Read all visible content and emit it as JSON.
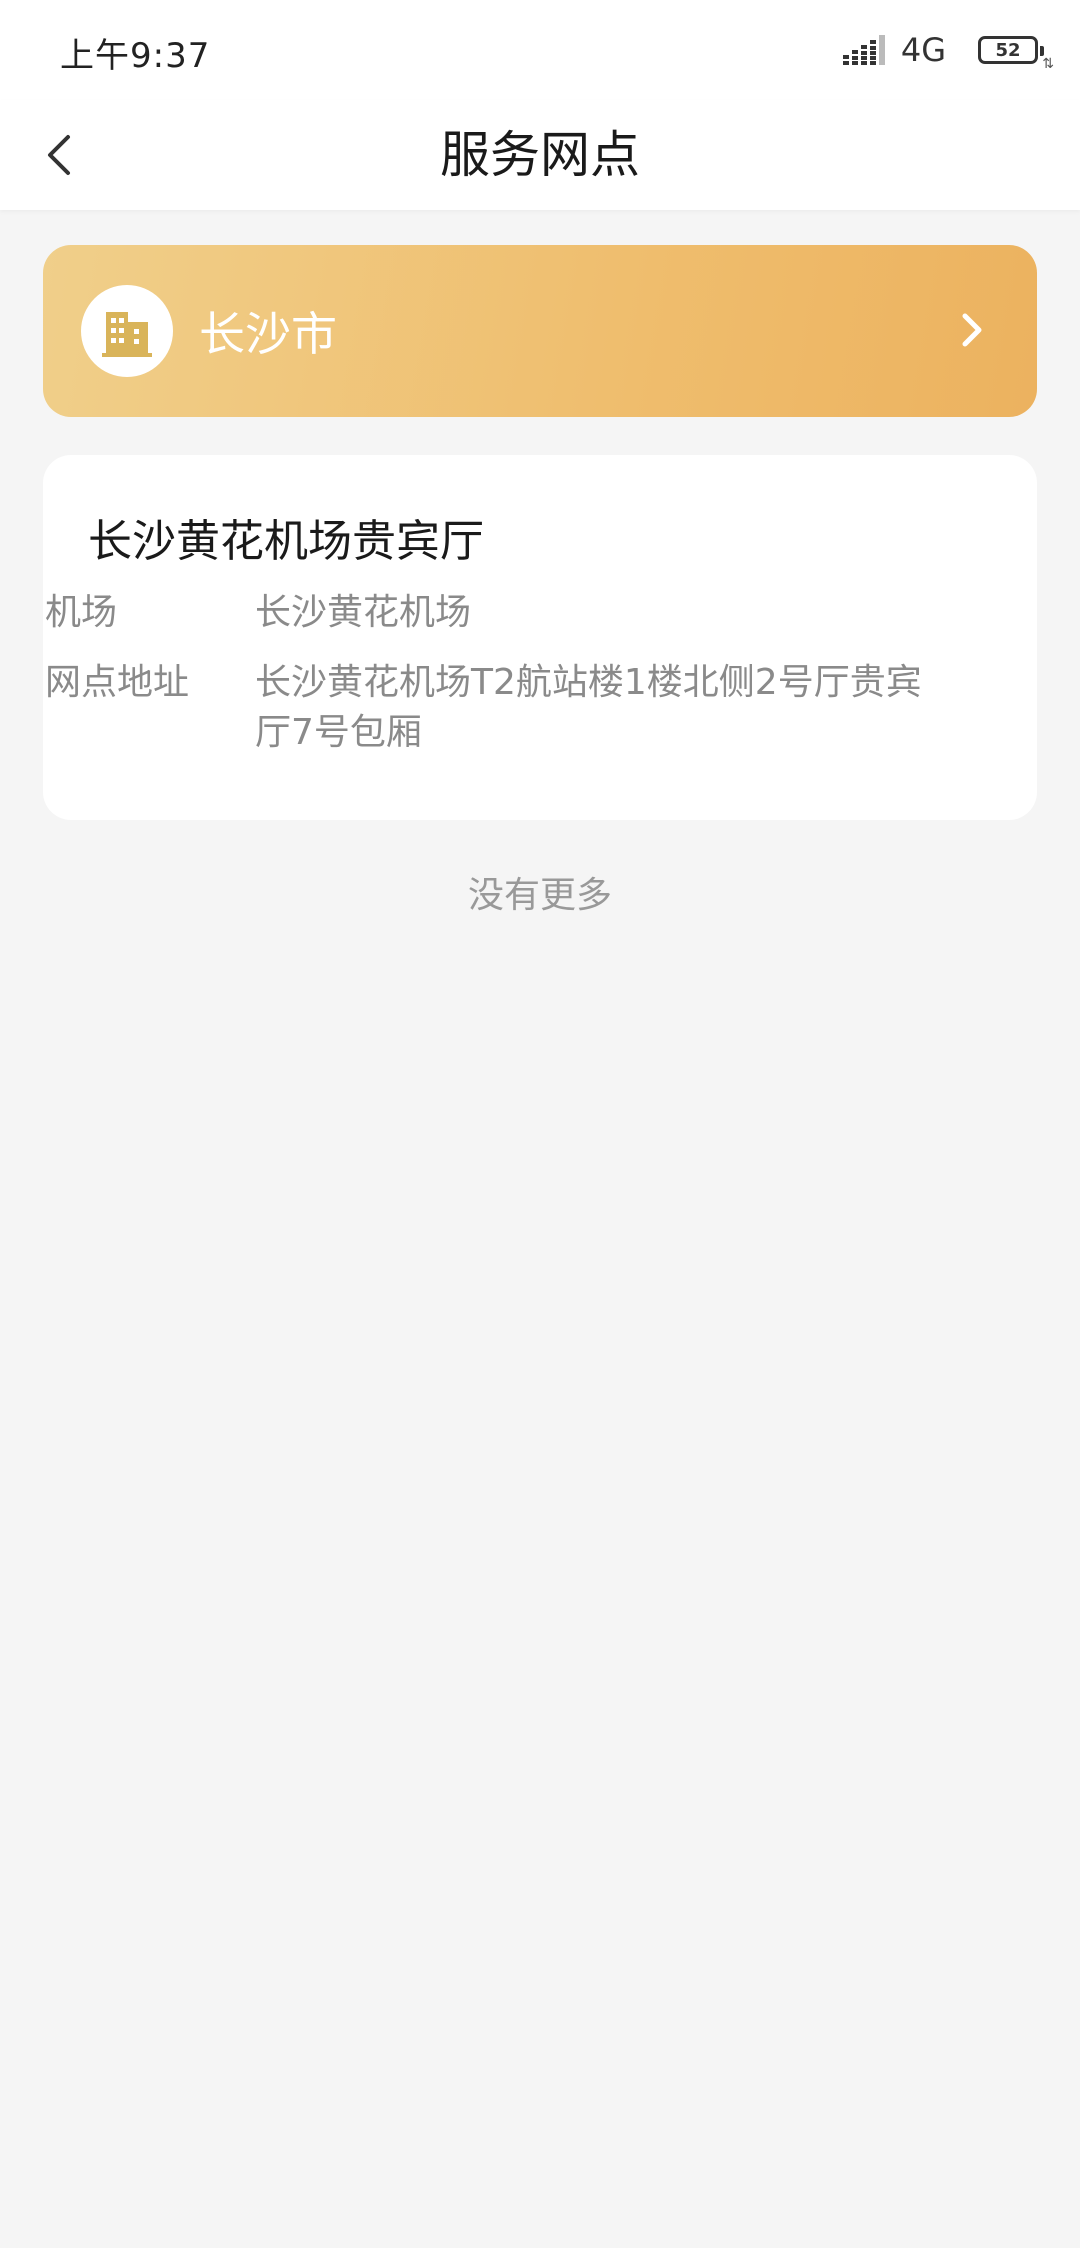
{
  "status_bar": {
    "time": "上午9:37",
    "network": "4G",
    "battery": "52"
  },
  "header": {
    "title": "服务网点"
  },
  "city": {
    "name": "长沙市"
  },
  "outlet": {
    "name": "长沙黄花机场贵宾厅",
    "airport_label": "机场",
    "airport_value": "长沙黄花机场",
    "address_label": "网点地址",
    "address_value": "长沙黄花机场T2航站楼1楼北侧2号厅贵宾厅7号包厢"
  },
  "footer": {
    "no_more": "没有更多"
  },
  "colors": {
    "accent_start": "#f0cf8a",
    "accent_end": "#ecb25f",
    "icon": "#d9b45a",
    "background": "#f5f5f5"
  },
  "icons": {
    "back": "chevron-left-icon",
    "city": "building-icon",
    "city_arrow": "chevron-right-icon",
    "signal": "signal-icon"
  }
}
